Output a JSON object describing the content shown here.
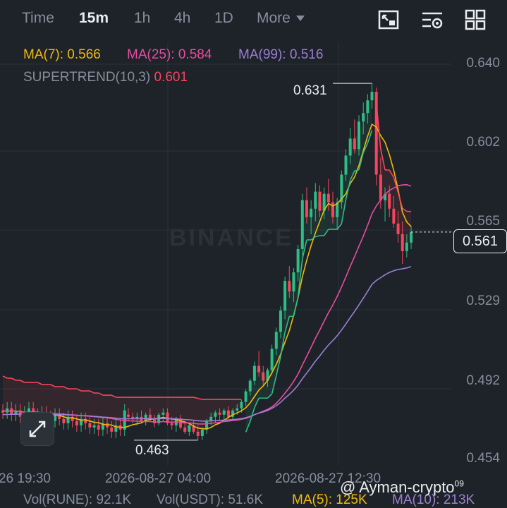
{
  "tabs": [
    {
      "label": "Time",
      "active": false
    },
    {
      "label": "15m",
      "active": true
    },
    {
      "label": "1h",
      "active": false
    },
    {
      "label": "4h",
      "active": false
    },
    {
      "label": "1D",
      "active": false
    },
    {
      "label": "More",
      "active": false
    }
  ],
  "toolbar": {
    "icons": [
      "chart-settings-icon",
      "indicator-settings-icon",
      "layout-grid-icon"
    ]
  },
  "indicators": {
    "ma7": {
      "label": "MA(7): 0.566",
      "color": "#f0b90b"
    },
    "ma25": {
      "label": "MA(25): 0.584",
      "color": "#e84ca0"
    },
    "ma99": {
      "label": "MA(99): 0.516",
      "color": "#9b7fd4"
    },
    "supertrend_name": "SUPERTREND(10,3)",
    "supertrend_value": "0.601",
    "supertrend_color": "#f6465d"
  },
  "price_axis": [
    "0.640",
    "0.602",
    "0.565",
    "0.529",
    "0.492",
    "0.454"
  ],
  "current_price": "0.561",
  "high_marker": "0.631",
  "low_marker": "0.463",
  "time_axis": [
    "26 19:30",
    "2026-08-27 04:00",
    "2026-08-27 12:30"
  ],
  "watermark": "BINANCE",
  "volume_bar": {
    "rune": "Vol(RUNE): 92.1K",
    "usdt": "Vol(USDT): 51.6K",
    "ma5": "MA(5): 125K",
    "ma10": "MA(10): 213K"
  },
  "credit": {
    "text": "@ Ayman-crypto",
    "sup": "09"
  },
  "colors": {
    "up": "#2ebd85",
    "down": "#f6465d",
    "bg": "#1e2329",
    "grid": "#2b3139"
  },
  "chart_data": {
    "type": "candlestick",
    "interval": "15m",
    "ylim": [
      0.454,
      0.64
    ],
    "candles": [
      [
        0.475,
        0.478,
        0.472,
        0.474
      ],
      [
        0.474,
        0.476,
        0.471,
        0.473
      ],
      [
        0.473,
        0.476,
        0.47,
        0.474
      ],
      [
        0.474,
        0.477,
        0.471,
        0.472
      ],
      [
        0.472,
        0.476,
        0.47,
        0.475
      ],
      [
        0.475,
        0.478,
        0.472,
        0.473
      ],
      [
        0.473,
        0.475,
        0.469,
        0.471
      ],
      [
        0.471,
        0.476,
        0.47,
        0.475
      ],
      [
        0.475,
        0.478,
        0.472,
        0.476
      ],
      [
        0.476,
        0.478,
        0.47,
        0.471
      ],
      [
        0.471,
        0.474,
        0.468,
        0.47
      ],
      [
        0.47,
        0.474,
        0.467,
        0.473
      ],
      [
        0.473,
        0.475,
        0.468,
        0.469
      ],
      [
        0.469,
        0.472,
        0.466,
        0.467
      ],
      [
        0.467,
        0.471,
        0.465,
        0.47
      ],
      [
        0.47,
        0.472,
        0.466,
        0.467
      ],
      [
        0.467,
        0.47,
        0.463,
        0.465
      ],
      [
        0.465,
        0.469,
        0.463,
        0.468
      ],
      [
        0.468,
        0.473,
        0.466,
        0.472
      ],
      [
        0.472,
        0.476,
        0.47,
        0.474
      ],
      [
        0.474,
        0.477,
        0.471,
        0.476
      ],
      [
        0.476,
        0.478,
        0.472,
        0.475
      ],
      [
        0.475,
        0.478,
        0.472,
        0.477
      ],
      [
        0.477,
        0.479,
        0.473,
        0.474
      ],
      [
        0.474,
        0.478,
        0.472,
        0.477
      ],
      [
        0.477,
        0.48,
        0.475,
        0.478
      ],
      [
        0.478,
        0.482,
        0.476,
        0.481
      ],
      [
        0.481,
        0.487,
        0.479,
        0.486
      ],
      [
        0.486,
        0.492,
        0.484,
        0.491
      ],
      [
        0.491,
        0.5,
        0.489,
        0.498
      ],
      [
        0.498,
        0.505,
        0.493,
        0.495
      ],
      [
        0.495,
        0.498,
        0.489,
        0.491
      ],
      [
        0.491,
        0.497,
        0.488,
        0.496
      ],
      [
        0.496,
        0.508,
        0.494,
        0.506
      ],
      [
        0.506,
        0.516,
        0.503,
        0.514
      ],
      [
        0.514,
        0.526,
        0.511,
        0.524
      ],
      [
        0.524,
        0.54,
        0.52,
        0.538
      ],
      [
        0.538,
        0.545,
        0.53,
        0.533
      ],
      [
        0.533,
        0.544,
        0.528,
        0.542
      ],
      [
        0.542,
        0.555,
        0.538,
        0.553
      ],
      [
        0.553,
        0.579,
        0.55,
        0.576
      ],
      [
        0.576,
        0.582,
        0.565,
        0.568
      ],
      [
        0.568,
        0.576,
        0.56,
        0.572
      ],
      [
        0.572,
        0.584,
        0.566,
        0.58
      ],
      [
        0.58,
        0.583,
        0.568,
        0.571
      ],
      [
        0.571,
        0.582,
        0.567,
        0.579
      ],
      [
        0.579,
        0.586,
        0.571,
        0.575
      ],
      [
        0.575,
        0.58,
        0.565,
        0.568
      ],
      [
        0.568,
        0.577,
        0.562,
        0.575
      ],
      [
        0.575,
        0.59,
        0.572,
        0.588
      ],
      [
        0.588,
        0.6,
        0.585,
        0.597
      ],
      [
        0.597,
        0.61,
        0.593,
        0.605
      ],
      [
        0.605,
        0.614,
        0.598,
        0.6
      ],
      [
        0.6,
        0.616,
        0.597,
        0.613
      ],
      [
        0.613,
        0.622,
        0.607,
        0.617
      ],
      [
        0.617,
        0.626,
        0.612,
        0.623
      ],
      [
        0.623,
        0.631,
        0.619,
        0.627
      ],
      [
        0.627,
        0.629,
        0.583,
        0.588
      ],
      [
        0.588,
        0.596,
        0.572,
        0.576
      ],
      [
        0.576,
        0.582,
        0.566,
        0.579
      ],
      [
        0.579,
        0.583,
        0.568,
        0.572
      ],
      [
        0.572,
        0.578,
        0.563,
        0.565
      ],
      [
        0.565,
        0.571,
        0.556,
        0.56
      ],
      [
        0.56,
        0.566,
        0.546,
        0.552
      ],
      [
        0.552,
        0.56,
        0.549,
        0.556
      ],
      [
        0.556,
        0.564,
        0.553,
        0.561
      ]
    ]
  }
}
